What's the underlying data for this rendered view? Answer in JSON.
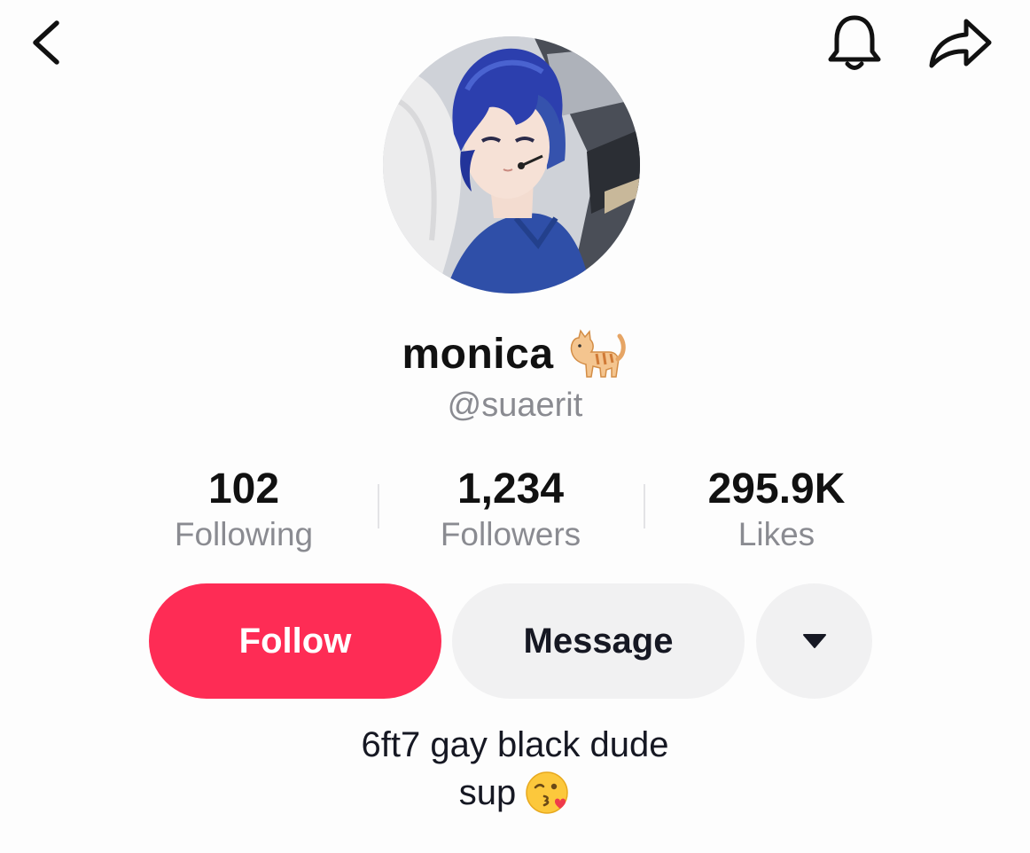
{
  "header": {
    "back_icon": "chevron-left-icon",
    "notification_icon": "bell-icon",
    "share_icon": "share-arrow-icon"
  },
  "profile": {
    "display_name": "monica",
    "name_emoji": "cat-emoji",
    "handle": "@suaerit",
    "avatar": "anime-character-avatar"
  },
  "stats": [
    {
      "value": "102",
      "label": "Following"
    },
    {
      "value": "1,234",
      "label": "Followers"
    },
    {
      "value": "295.9K",
      "label": "Likes"
    }
  ],
  "actions": {
    "follow_label": "Follow",
    "message_label": "Message",
    "more_icon": "caret-down-icon"
  },
  "bio": {
    "line1": "6ft7 gay black dude",
    "line2": "sup",
    "line2_emoji": "kissing-face-emoji"
  },
  "colors": {
    "follow_bg": "#fe2c55",
    "secondary_btn_bg": "#f1f1f2",
    "muted_text": "#8a8b91",
    "text": "#161823"
  }
}
